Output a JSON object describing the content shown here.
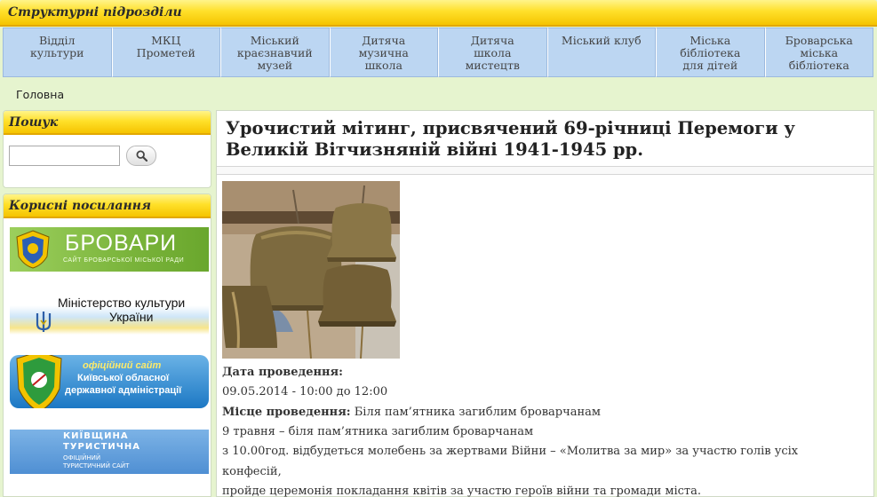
{
  "topbar": {
    "title": "Структурні підрозділи"
  },
  "nav": {
    "items": [
      {
        "label": "Відділ\nкультури"
      },
      {
        "label": "МКЦ\nПрометей"
      },
      {
        "label": "Міський\nкраєзнавчий\nмузей"
      },
      {
        "label": "Дитяча\nмузична\nшкола"
      },
      {
        "label": "Дитяча\nшкола\nмистецтв"
      },
      {
        "label": "Міський клуб"
      },
      {
        "label": "Міська\nбібліотека\nдля дітей"
      },
      {
        "label": "Броварська\nміська\nбібліотека"
      }
    ]
  },
  "breadcrumb": {
    "home": "Головна"
  },
  "sidebar": {
    "search_title": "Пошук",
    "search_value": "",
    "search_icon": "magnifier-icon",
    "links_title": "Корисні посилання",
    "banners": {
      "brovary": {
        "title": "БРОВАРИ",
        "subtitle": "САЙТ БРОВАРСЬКОЇ МІСЬКОЇ РАДИ"
      },
      "minkult": {
        "line1": "Міністерство культури",
        "line2": "України"
      },
      "kyivoda": {
        "line1": "офіційний сайт",
        "line2": "Київської обласної",
        "line3": "державної адміністрації"
      },
      "tour": {
        "line1": "КИЇВЩИНА",
        "line2": "ТУРИСТИЧНА",
        "line3": "ОФІЦІЙНИЙ",
        "line4": "ТУРИСТИЧНИЙ САЙТ"
      }
    }
  },
  "article": {
    "title": "Урочистий мітинг, присвячений 69-річниці Перемоги у Великій Вітчизняній війні 1941-1945 рр.",
    "date_label": "Дата проведення:",
    "date_value": "09.05.2014 - 10:00 до 12:00",
    "place_label": "Місце проведення:",
    "place_value": "Біля пам’ятника загиблим броварчанам",
    "line1": "9 травня – біля пам’ятника загиблим броварчанам",
    "line2": "з 10.00год. відбудеться молебень за жертвами Війни – «Молитва за мир» за участю голів усіх",
    "line3": "конфесій,",
    "line4": "пройде церемонія покладання квітів за участю героїв війни та громади міста."
  },
  "colors": {
    "header_yellow": "#ffe02a",
    "nav_blue": "#bcd6f2",
    "page_green": "#e6f4cf"
  }
}
